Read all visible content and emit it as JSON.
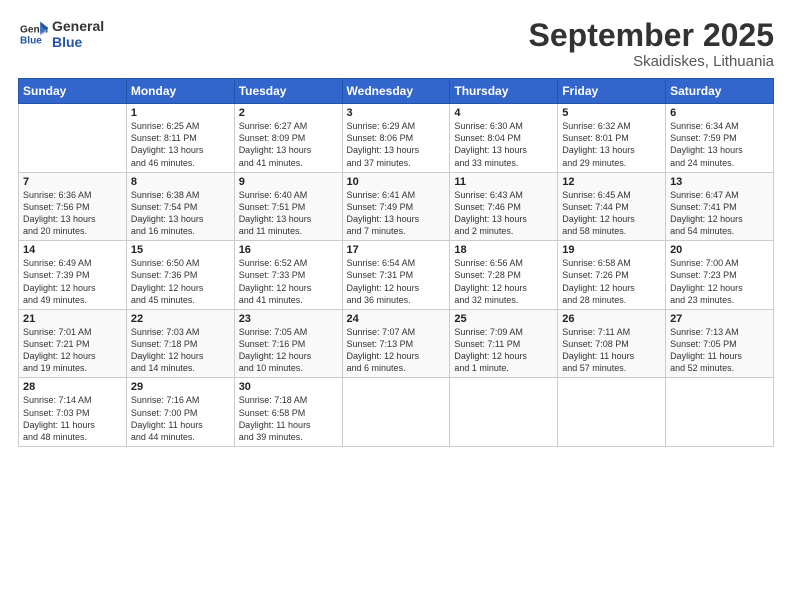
{
  "header": {
    "logo_general": "General",
    "logo_blue": "Blue",
    "month_title": "September 2025",
    "location": "Skaidiskes, Lithuania"
  },
  "weekdays": [
    "Sunday",
    "Monday",
    "Tuesday",
    "Wednesday",
    "Thursday",
    "Friday",
    "Saturday"
  ],
  "weeks": [
    [
      {
        "day": "",
        "content": ""
      },
      {
        "day": "1",
        "content": "Sunrise: 6:25 AM\nSunset: 8:11 PM\nDaylight: 13 hours\nand 46 minutes."
      },
      {
        "day": "2",
        "content": "Sunrise: 6:27 AM\nSunset: 8:09 PM\nDaylight: 13 hours\nand 41 minutes."
      },
      {
        "day": "3",
        "content": "Sunrise: 6:29 AM\nSunset: 8:06 PM\nDaylight: 13 hours\nand 37 minutes."
      },
      {
        "day": "4",
        "content": "Sunrise: 6:30 AM\nSunset: 8:04 PM\nDaylight: 13 hours\nand 33 minutes."
      },
      {
        "day": "5",
        "content": "Sunrise: 6:32 AM\nSunset: 8:01 PM\nDaylight: 13 hours\nand 29 minutes."
      },
      {
        "day": "6",
        "content": "Sunrise: 6:34 AM\nSunset: 7:59 PM\nDaylight: 13 hours\nand 24 minutes."
      }
    ],
    [
      {
        "day": "7",
        "content": "Sunrise: 6:36 AM\nSunset: 7:56 PM\nDaylight: 13 hours\nand 20 minutes."
      },
      {
        "day": "8",
        "content": "Sunrise: 6:38 AM\nSunset: 7:54 PM\nDaylight: 13 hours\nand 16 minutes."
      },
      {
        "day": "9",
        "content": "Sunrise: 6:40 AM\nSunset: 7:51 PM\nDaylight: 13 hours\nand 11 minutes."
      },
      {
        "day": "10",
        "content": "Sunrise: 6:41 AM\nSunset: 7:49 PM\nDaylight: 13 hours\nand 7 minutes."
      },
      {
        "day": "11",
        "content": "Sunrise: 6:43 AM\nSunset: 7:46 PM\nDaylight: 13 hours\nand 2 minutes."
      },
      {
        "day": "12",
        "content": "Sunrise: 6:45 AM\nSunset: 7:44 PM\nDaylight: 12 hours\nand 58 minutes."
      },
      {
        "day": "13",
        "content": "Sunrise: 6:47 AM\nSunset: 7:41 PM\nDaylight: 12 hours\nand 54 minutes."
      }
    ],
    [
      {
        "day": "14",
        "content": "Sunrise: 6:49 AM\nSunset: 7:39 PM\nDaylight: 12 hours\nand 49 minutes."
      },
      {
        "day": "15",
        "content": "Sunrise: 6:50 AM\nSunset: 7:36 PM\nDaylight: 12 hours\nand 45 minutes."
      },
      {
        "day": "16",
        "content": "Sunrise: 6:52 AM\nSunset: 7:33 PM\nDaylight: 12 hours\nand 41 minutes."
      },
      {
        "day": "17",
        "content": "Sunrise: 6:54 AM\nSunset: 7:31 PM\nDaylight: 12 hours\nand 36 minutes."
      },
      {
        "day": "18",
        "content": "Sunrise: 6:56 AM\nSunset: 7:28 PM\nDaylight: 12 hours\nand 32 minutes."
      },
      {
        "day": "19",
        "content": "Sunrise: 6:58 AM\nSunset: 7:26 PM\nDaylight: 12 hours\nand 28 minutes."
      },
      {
        "day": "20",
        "content": "Sunrise: 7:00 AM\nSunset: 7:23 PM\nDaylight: 12 hours\nand 23 minutes."
      }
    ],
    [
      {
        "day": "21",
        "content": "Sunrise: 7:01 AM\nSunset: 7:21 PM\nDaylight: 12 hours\nand 19 minutes."
      },
      {
        "day": "22",
        "content": "Sunrise: 7:03 AM\nSunset: 7:18 PM\nDaylight: 12 hours\nand 14 minutes."
      },
      {
        "day": "23",
        "content": "Sunrise: 7:05 AM\nSunset: 7:16 PM\nDaylight: 12 hours\nand 10 minutes."
      },
      {
        "day": "24",
        "content": "Sunrise: 7:07 AM\nSunset: 7:13 PM\nDaylight: 12 hours\nand 6 minutes."
      },
      {
        "day": "25",
        "content": "Sunrise: 7:09 AM\nSunset: 7:11 PM\nDaylight: 12 hours\nand 1 minute."
      },
      {
        "day": "26",
        "content": "Sunrise: 7:11 AM\nSunset: 7:08 PM\nDaylight: 11 hours\nand 57 minutes."
      },
      {
        "day": "27",
        "content": "Sunrise: 7:13 AM\nSunset: 7:05 PM\nDaylight: 11 hours\nand 52 minutes."
      }
    ],
    [
      {
        "day": "28",
        "content": "Sunrise: 7:14 AM\nSunset: 7:03 PM\nDaylight: 11 hours\nand 48 minutes."
      },
      {
        "day": "29",
        "content": "Sunrise: 7:16 AM\nSunset: 7:00 PM\nDaylight: 11 hours\nand 44 minutes."
      },
      {
        "day": "30",
        "content": "Sunrise: 7:18 AM\nSunset: 6:58 PM\nDaylight: 11 hours\nand 39 minutes."
      },
      {
        "day": "",
        "content": ""
      },
      {
        "day": "",
        "content": ""
      },
      {
        "day": "",
        "content": ""
      },
      {
        "day": "",
        "content": ""
      }
    ]
  ]
}
